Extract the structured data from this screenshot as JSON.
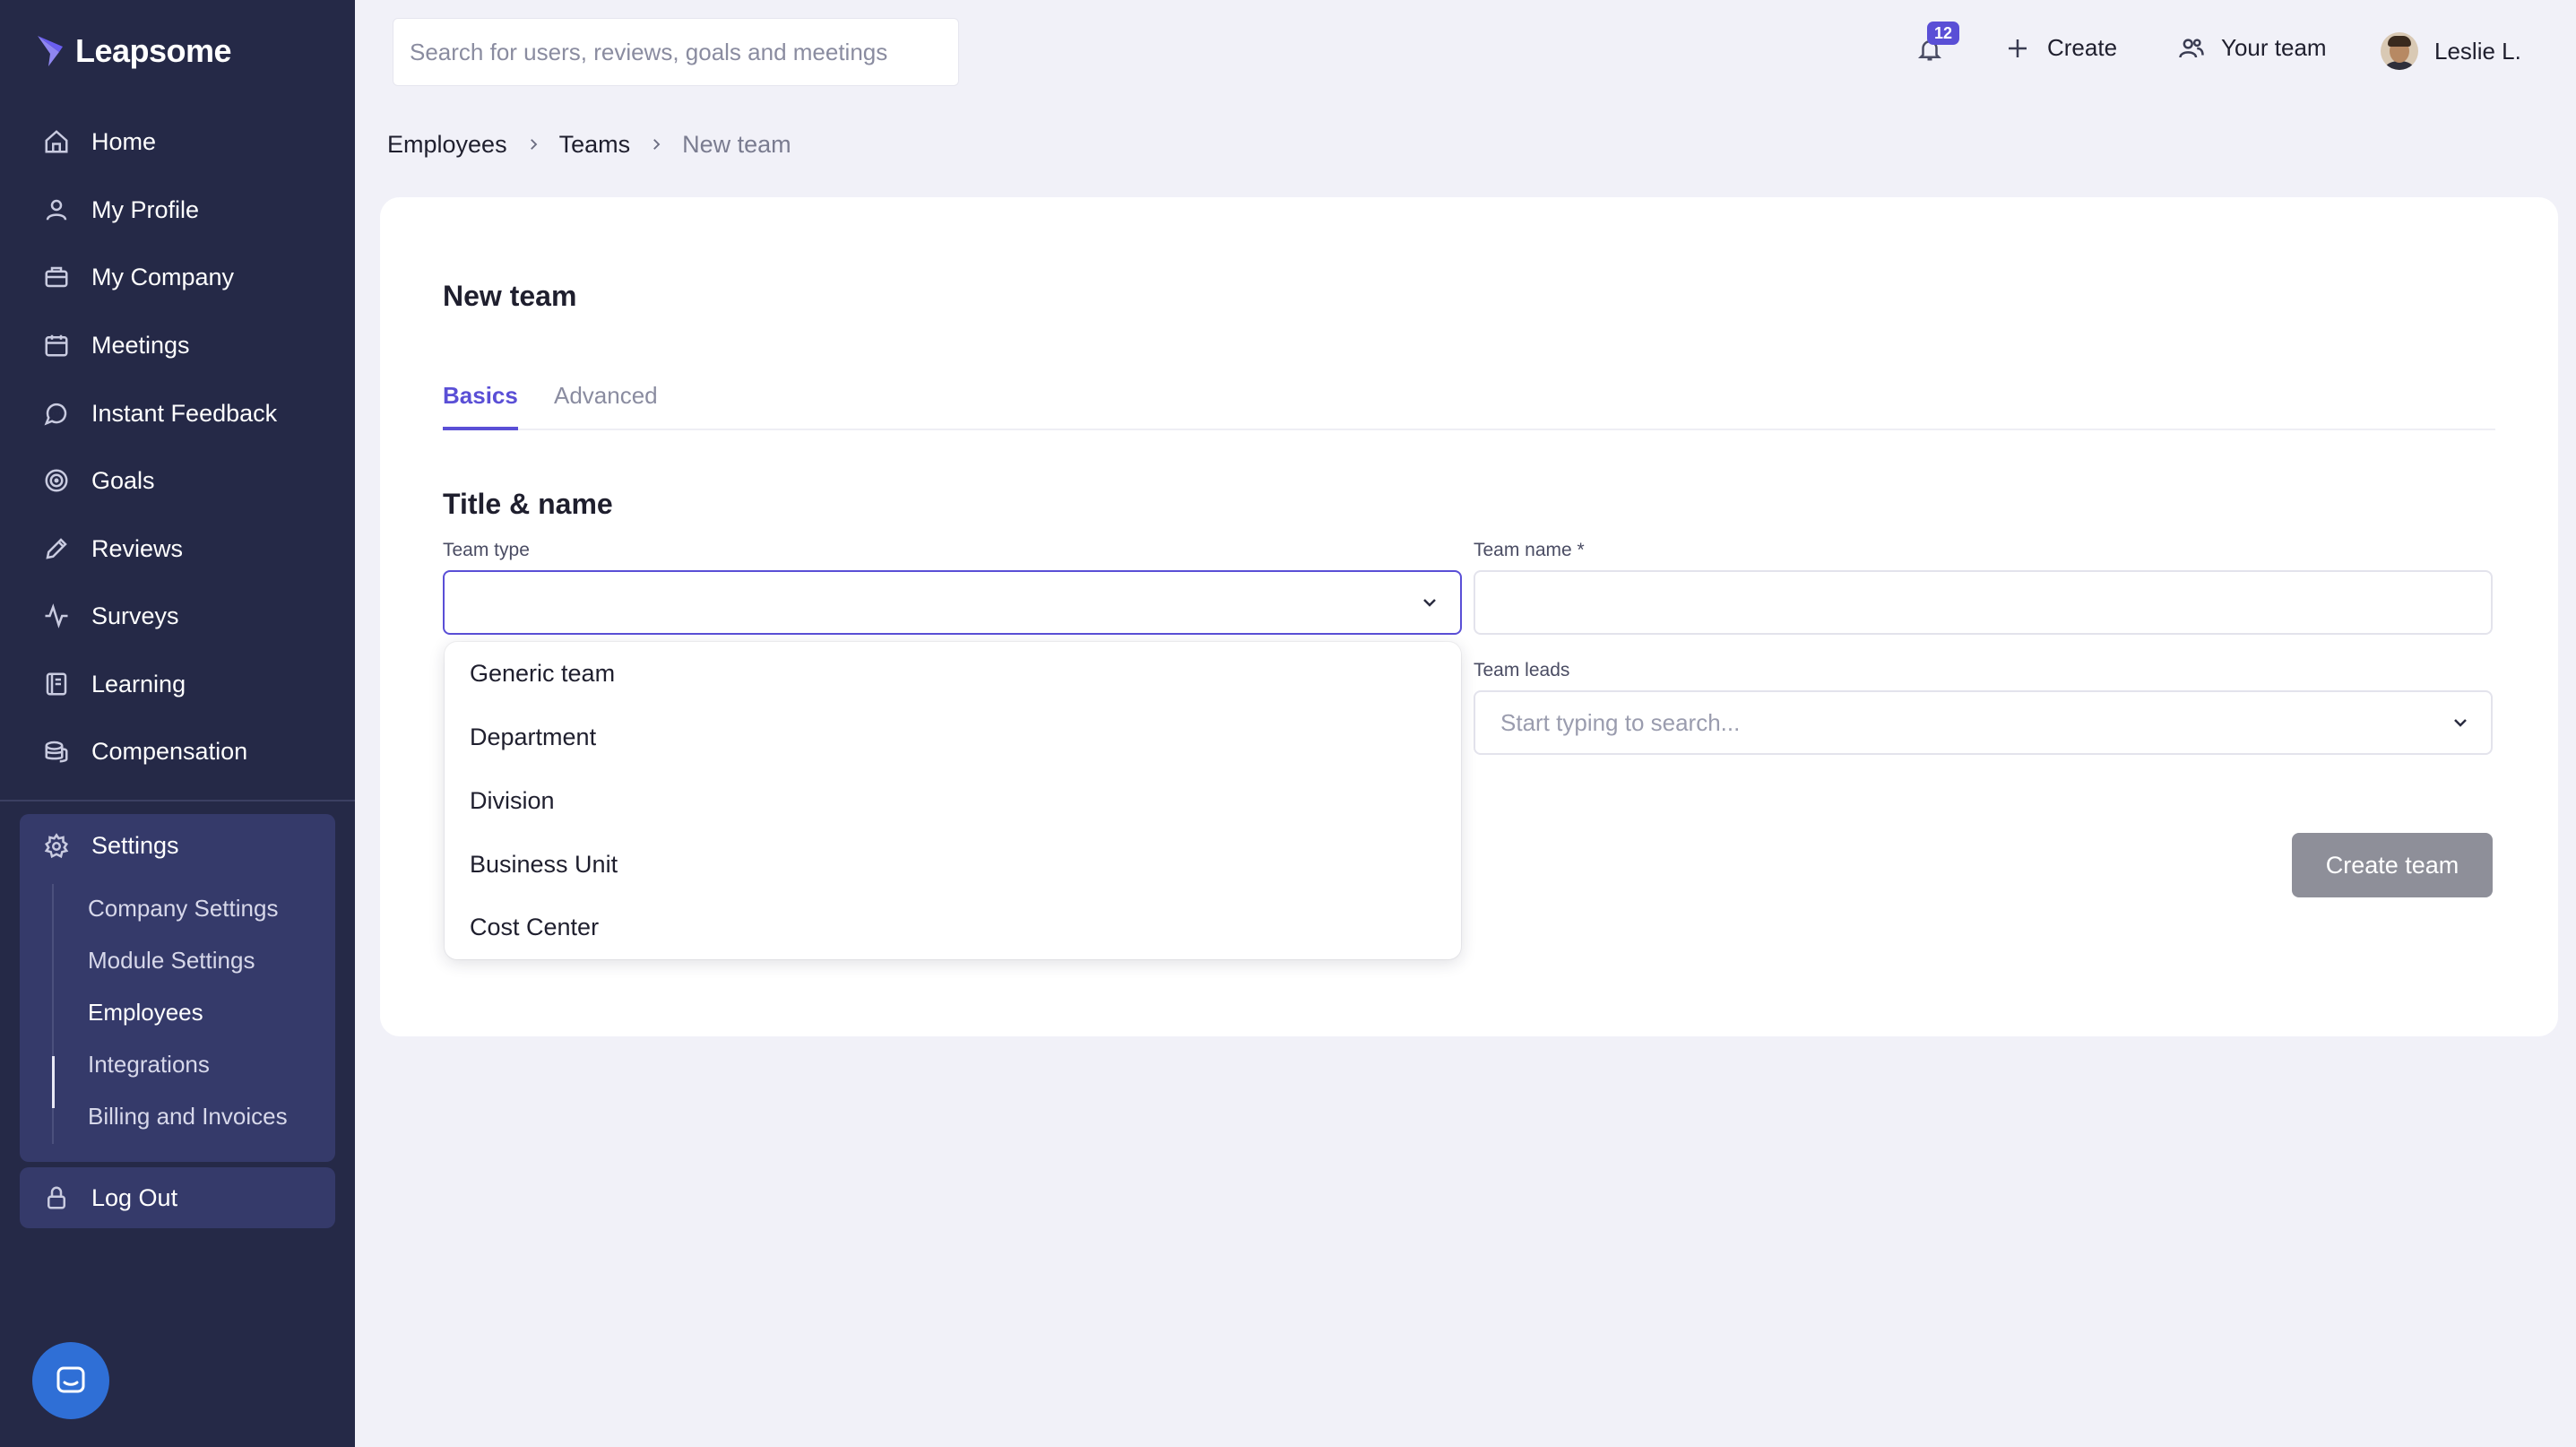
{
  "app": {
    "logo_text": "Leapsome",
    "brand_color": "#5a4fd6",
    "sidebar_color": "#252947"
  },
  "sidebar": {
    "items": [
      {
        "label": "Home",
        "icon": "home-icon"
      },
      {
        "label": "My Profile",
        "icon": "user-icon"
      },
      {
        "label": "My Company",
        "icon": "building-icon"
      },
      {
        "label": "Meetings",
        "icon": "calendar-icon"
      },
      {
        "label": "Instant Feedback",
        "icon": "chat-icon"
      },
      {
        "label": "Goals",
        "icon": "target-icon"
      },
      {
        "label": "Reviews",
        "icon": "pencil-icon"
      },
      {
        "label": "Surveys",
        "icon": "pulse-icon"
      },
      {
        "label": "Learning",
        "icon": "book-icon"
      },
      {
        "label": "Compensation",
        "icon": "coins-icon"
      }
    ],
    "settings": {
      "label": "Settings",
      "icon": "gear-icon",
      "sub_items": [
        {
          "label": "Company Settings"
        },
        {
          "label": "Module Settings"
        },
        {
          "label": "Employees",
          "active": true
        },
        {
          "label": "Integrations"
        },
        {
          "label": "Billing and Invoices"
        }
      ]
    },
    "logout": {
      "label": "Log Out",
      "icon": "lock-icon"
    }
  },
  "topbar": {
    "search_placeholder": "Search for users, reviews, goals and meetings",
    "notifications_count": "12",
    "create_label": "Create",
    "your_team_label": "Your team",
    "user_name": "Leslie L."
  },
  "breadcrumb": {
    "items": [
      "Employees",
      "Teams"
    ],
    "current": "New team"
  },
  "form": {
    "title": "New team",
    "tabs": [
      {
        "label": "Basics",
        "active": true
      },
      {
        "label": "Advanced",
        "active": false
      }
    ],
    "section_title": "Title & name",
    "team_type": {
      "label": "Team type",
      "value": ""
    },
    "team_name": {
      "label": "Team name *",
      "value": ""
    },
    "team_leads": {
      "label": "Team leads",
      "placeholder": "Start typing to search..."
    },
    "submit_label": "Create team",
    "team_type_options": [
      "Generic team",
      "Department",
      "Division",
      "Business Unit",
      "Cost Center"
    ]
  }
}
